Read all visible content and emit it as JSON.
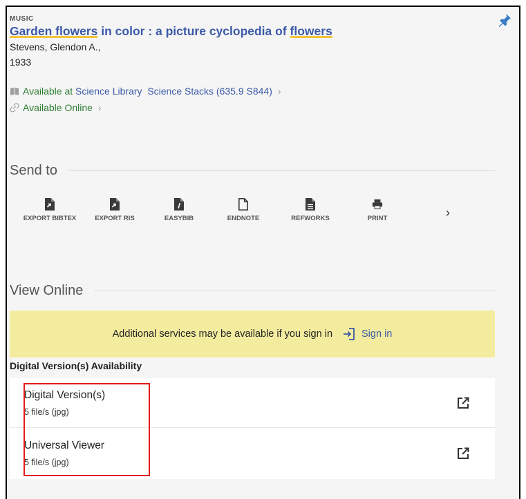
{
  "record": {
    "type": "MUSIC",
    "title_parts": [
      "Garden flowers",
      " in color : a picture cyclopedia of ",
      "flowers"
    ],
    "author": "Stevens, Glendon A.,",
    "year": "1933",
    "availability": {
      "status": "Available at",
      "library": "Science Library",
      "location": "Science Stacks (635.9 S844)",
      "online": "Available Online"
    }
  },
  "send_to": {
    "heading": "Send to",
    "items": [
      {
        "id": "bibtex",
        "label": "EXPORT BIBTEX",
        "icon": "file-export-icon"
      },
      {
        "id": "ris",
        "label": "EXPORT RIS",
        "icon": "file-export-icon"
      },
      {
        "id": "easybib",
        "label": "EASYBIB",
        "icon": "file-easybib-icon"
      },
      {
        "id": "endnote",
        "label": "ENDNOTE",
        "icon": "file-outline-icon"
      },
      {
        "id": "refworks",
        "label": "REFWORKS",
        "icon": "file-lines-icon"
      },
      {
        "id": "print",
        "label": "PRINT",
        "icon": "printer-icon"
      }
    ],
    "next_glyph": "›"
  },
  "view_online": {
    "heading": "View Online",
    "signin_message": "Additional services may be available if you sign in",
    "signin_label": "Sign in",
    "digital_heading": "Digital Version(s) Availability",
    "links": [
      {
        "name": "Digital Version(s)",
        "meta": "5 file/s (jpg)"
      },
      {
        "name": "Universal Viewer",
        "meta": "5 file/s (jpg)"
      }
    ]
  },
  "colors": {
    "link_blue": "#3c5aa8",
    "available_green": "#2e7d32",
    "highlight_yellow": "#f2c43c",
    "signin_bg": "#f3ec9f",
    "annotation_red": "#e41b1b"
  }
}
